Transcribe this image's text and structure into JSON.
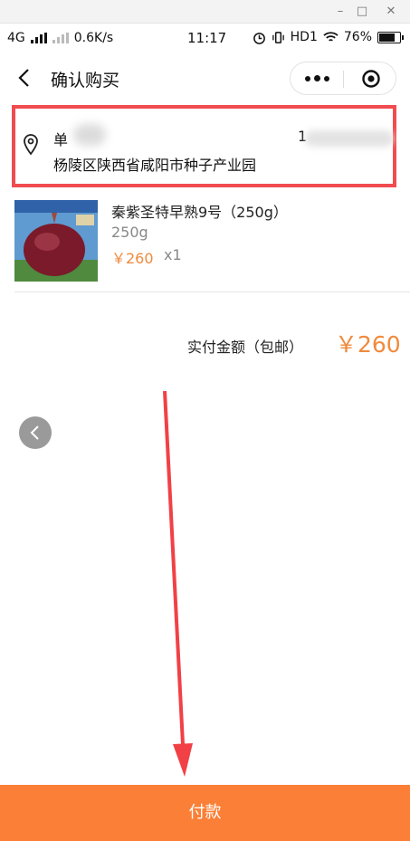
{
  "window": {
    "minimize_icon": "minimize-icon",
    "maximize_icon": "maximize-icon",
    "close_icon": "close-icon"
  },
  "status_bar": {
    "network": "4G",
    "speed": "0.6K/s",
    "time": "11:17",
    "hd": "HD1",
    "battery": "76%",
    "battery_level": 0.76
  },
  "nav": {
    "title": "确认购买"
  },
  "address": {
    "name": "单",
    "line": "杨陵区陕西省咸阳市种子产业园",
    "phone_visible": "1"
  },
  "item": {
    "name": "秦紫圣特早熟9号（250g）",
    "spec": "250g",
    "price": "￥260",
    "qty": "x1"
  },
  "summary": {
    "label": "实付金额（包邮）",
    "value": "￥260"
  },
  "colors": {
    "accent": "#fb7f36",
    "price": "#f08a3c",
    "highlight": "#f04c50"
  },
  "pay_button": {
    "label": "付款"
  }
}
